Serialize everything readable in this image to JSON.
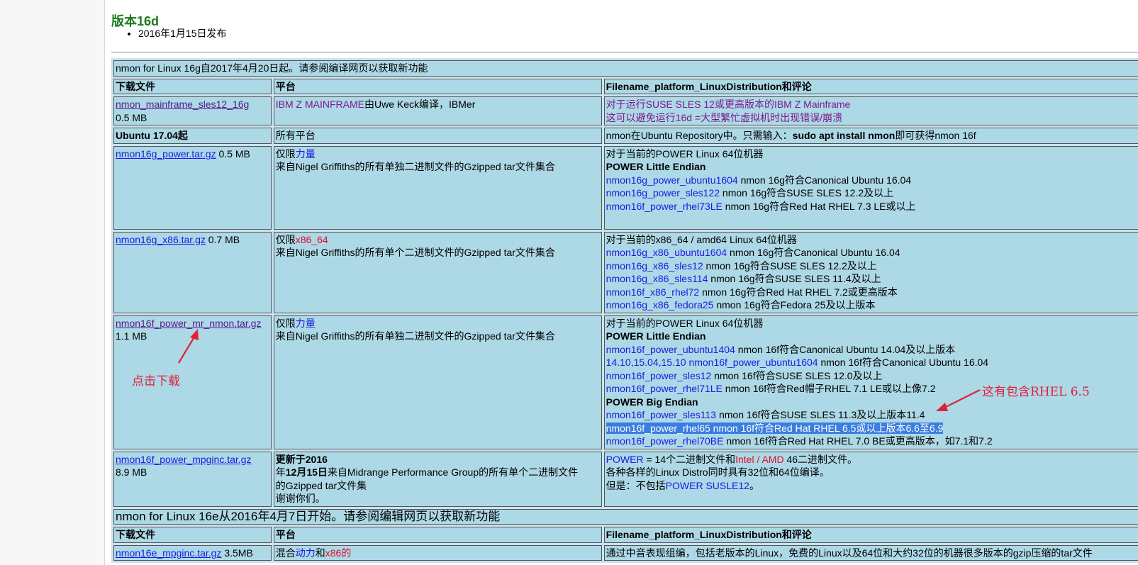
{
  "version_title": "版本16d",
  "version_date": "2016年1月15日发布",
  "section1": {
    "title": "nmon for Linux 16g自2017年4月20日起。请参阅编译网页以获取新功能",
    "headers": [
      "下载文件",
      "平台",
      "Filename_platform_LinuxDistribution和评论"
    ],
    "row1": {
      "file": "nmon_mainframe_sles12_16g",
      "size": "0.5 MB",
      "platform_link": "IBM Z MAINFRAME",
      "platform_rest": "由Uwe Keck编译，IBMer",
      "comment_1": "对于运行SUSE SLES 12或更高版本的IBM Z Mainframe",
      "comment_2": "这可以避免运行16d =大型繁忙虚拟机时出现错误/崩溃"
    },
    "row2": {
      "file": "Ubuntu 17.04起",
      "platform": "所有平台",
      "comment_pre": "nmon在Ubuntu Repository中。只需输入：",
      "comment_cmd": "sudo apt install nmon",
      "comment_post": "即可获得nmon 16f"
    },
    "row3": {
      "file": "nmon16g_power.tar.gz",
      "size": "0.5 MB",
      "platform_pre": "仅限",
      "platform_link": "力量",
      "platform_desc": "来自Nigel Griffiths的所有单独二进制文件的Gzipped tar文件集合",
      "c_intro": "对于当前的POWER Linux 64位机器",
      "c_bold": "POWER Little Endian",
      "items": [
        {
          "link": "nmon16g_power_ubuntu1604",
          "text": " nmon 16g符合Canonical Ubuntu 16.04"
        },
        {
          "link": "nmon16g_power_sles122",
          "text": " nmon 16g符合SUSE SLES 12.2及以上"
        },
        {
          "link": "nmon16f_power_rhel73LE",
          "text": " nmon 16g符合Red Hat RHEL 7.3 LE或以上"
        }
      ]
    },
    "row4": {
      "file": "nmon16g_x86.tar.gz",
      "size": "0.7 MB",
      "platform_pre": "仅限",
      "platform_link": "x86_64",
      "platform_desc": "来自Nigel Griffiths的所有单个二进制文件的Gzipped tar文件集合",
      "c_intro": "对于当前的x86_64 / amd64 Linux 64位机器",
      "items": [
        {
          "link": "nmon16g_x86_ubuntu1604",
          "text": " nmon 16g符合Canonical Ubuntu 16.04"
        },
        {
          "link": "nmon16g_x86_sles12",
          "text": " nmon 16g符合SUSE SLES 12.2及以上"
        },
        {
          "link": "nmon16g_x86_sles114",
          "text": " nmon 16g符合SUSE SLES 11.4及以上"
        },
        {
          "link": "nmon16f_x86_rhel72",
          "text": " nmon 16g符合Red Hat RHEL 7.2或更高版本"
        },
        {
          "link": "nmon16g_x86_fedora25",
          "text": " nmon 16g符合Fedora 25及以上版本"
        }
      ]
    },
    "row5": {
      "file": "nmon16f_power_mr_nmon.tar.gz",
      "size": "1.1 MB",
      "platform_pre": "仅限",
      "platform_link": "力量",
      "platform_desc": "来自Nigel Griffiths的所有单独二进制文件的Gzipped tar文件集合",
      "c_intro": "对于当前的POWER Linux 64位机器",
      "c_bold1": "POWER Little Endian",
      "item1_link": "nmon16f_power_ubuntu1404",
      "item1_text": " nmon 16f符合Canonical Ubuntu 14.04及以上版本",
      "item2_link": "14.10,15.04,15.10 nmon16f_power_ubuntu1604",
      "item2_text": " nmon 16f符合Canonical Ubuntu 16.04",
      "item3_link": "nmon16f_power_sles12",
      "item3_text": " nmon 16f符合SUSE SLES 12.0及以上",
      "item4_link": "nmon16f_power_rhel71LE",
      "item4_text": " nmon 16f符合Red帽子RHEL 7.1 LE或以上像7.2",
      "c_bold2": "POWER Big Endian",
      "item5_link": "nmon16f_power_sles113",
      "item5_text": " nmon 16f符合SUSE SLES 11.3及以上版本11.4",
      "item6_selected": "nmon16f_power_rhel65 nmon 16f符合Red Hat RHEL 6.5或以上版本6.6至6.9",
      "item7_link": "nmon16f_power_rhel70BE",
      "item7_text": " nmon 16f符合Red Hat RHEL 7.0 BE或更高版本，如7.1和7.2"
    },
    "row6": {
      "file": "nmon16f_power_mpginc.tar.gz",
      "size": "8.9 MB",
      "platform_b1": "更新于2016",
      "platform_l2_pre": "年",
      "platform_l2_b": "12月15日",
      "platform_l2_post": "来自Midrange Performance Group的所有单个二进制文件",
      "platform_l3": "的Gzipped tar文件集",
      "platform_l4": "谢谢你们。",
      "c1_link": "POWER",
      "c1_mid": " = 14个二进制文件和",
      "c1_link2": "Intel / AMD",
      "c1_post": " 46二进制文件。",
      "c2": "各种各样的Linux Distro同时具有32位和64位编译。",
      "c3_pre": "但是：不包括",
      "c3_link": "POWER SUSLE12",
      "c3_post": "。"
    }
  },
  "section2": {
    "title": "nmon for Linux 16e从2016年4月7日开始。请参阅编辑网页以获取新功能",
    "headers": [
      "下载文件",
      "平台",
      "Filename_platform_LinuxDistribution和评论"
    ],
    "row1": {
      "file": "nmon16e_mpginc.tar.gz",
      "size": " 3.5MB",
      "platform_pre": "混合",
      "platform_link1": "动力",
      "platform_mid": "和",
      "platform_link2": "x86的",
      "comment": "通过中音表现组编，包括老版本的Linux，免费的Linux以及64位和大约32位的机器很多版本的gzip压缩的tar文件"
    }
  },
  "annotations": {
    "click_download": "点击下载",
    "rhel_note": "这有包含RHEL 6.5"
  },
  "colors": {
    "table_bg": "#add8e6",
    "link": "#1a1ae6",
    "visited": "#551a8b",
    "annotation": "#e0203a",
    "selection": "#3b7de0"
  }
}
